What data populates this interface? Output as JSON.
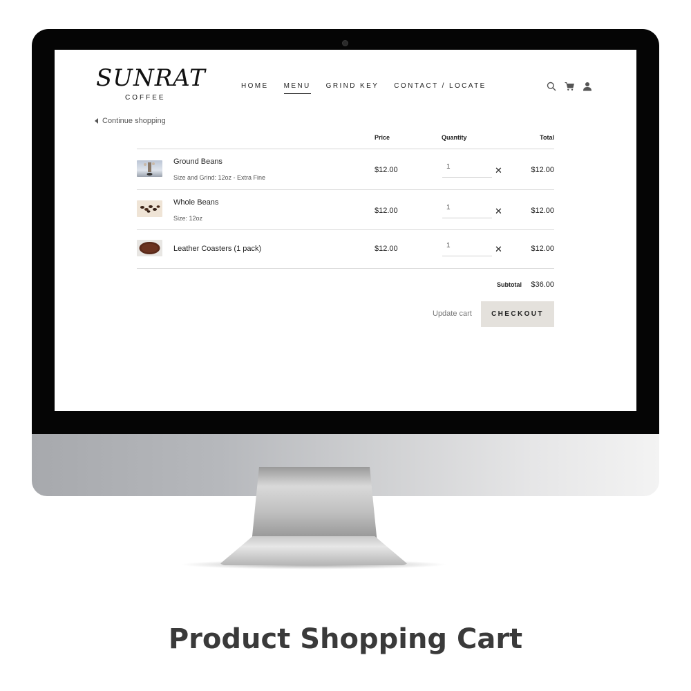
{
  "brand": {
    "logo_main": "SUNRAT",
    "logo_sub": "COFFEE"
  },
  "nav": {
    "items": [
      {
        "label": "HOME"
      },
      {
        "label": "MENU",
        "active": true
      },
      {
        "label": "GRIND KEY"
      },
      {
        "label": "CONTACT / LOCATE"
      }
    ]
  },
  "header_icons": [
    "search-icon",
    "cart-icon",
    "account-icon"
  ],
  "back_link": "Continue shopping",
  "table": {
    "headers": {
      "price": "Price",
      "quantity": "Quantity",
      "total": "Total"
    },
    "rows": [
      {
        "name": "Ground Beans",
        "variant": "Size and Grind:  12oz - Extra Fine",
        "price": "$12.00",
        "quantity": "1",
        "total": "$12.00",
        "remove": "✕"
      },
      {
        "name": "Whole Beans",
        "variant": "Size:  12oz",
        "price": "$12.00",
        "quantity": "1",
        "total": "$12.00",
        "remove": "✕"
      },
      {
        "name": "Leather Coasters (1 pack)",
        "variant": "",
        "price": "$12.00",
        "quantity": "1",
        "total": "$12.00",
        "remove": "✕"
      }
    ]
  },
  "summary": {
    "subtotal_label": "Subtotal",
    "subtotal_value": "$36.00"
  },
  "actions": {
    "update_cart": "Update cart",
    "checkout": "CHECKOUT"
  },
  "caption": "Product Shopping Cart",
  "colors": {
    "checkout_bg": "#e4e1dc",
    "bezel": "#050505"
  }
}
